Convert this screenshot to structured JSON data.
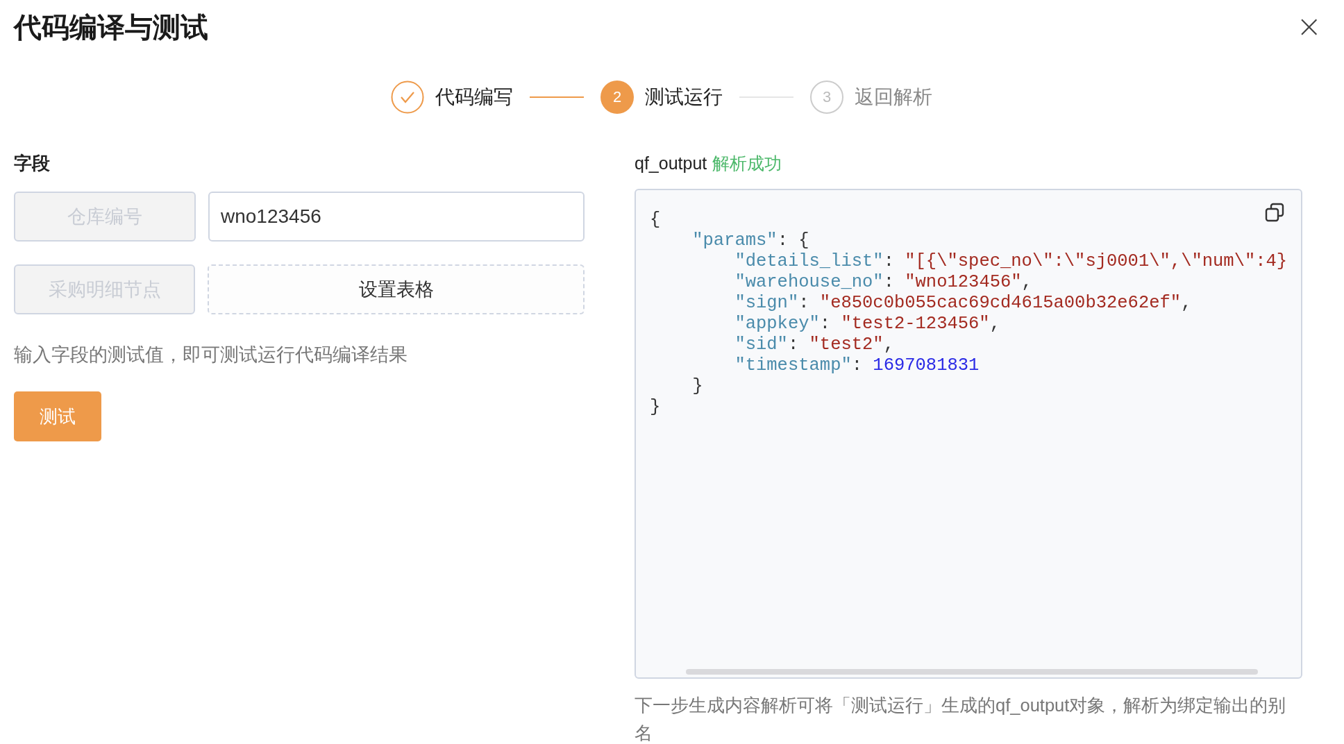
{
  "dialog": {
    "title": "代码编译与测试",
    "close_icon": "×"
  },
  "steps": [
    {
      "label": "代码编写",
      "completed": true,
      "selected": false
    },
    {
      "label": "测试运行",
      "number": "2",
      "completed": false,
      "selected": true
    },
    {
      "label": "返回解析",
      "number": "3",
      "completed": false,
      "selected": false
    }
  ],
  "fields": {
    "heading": "字段",
    "rows": [
      {
        "label": "仓库编号",
        "kind": "input",
        "value": "wno123456"
      },
      {
        "label": "采购明细节点",
        "kind": "button",
        "value": "设置表格"
      }
    ],
    "hint": "输入字段的测试值，即可测试运行代码编译结果",
    "test_button": "测试"
  },
  "output": {
    "name": "qf_output",
    "status": "解析成功",
    "code_lines": [
      {
        "tokens": [
          {
            "kind": "punct",
            "text": "{"
          }
        ],
        "children": [
          {
            "tokens": [
              {
                "kind": "key",
                "text": "\"params\""
              },
              {
                "kind": "punct",
                "text": ": {"
              }
            ],
            "children": [
              {
                "tokens": [
                  {
                    "kind": "key",
                    "text": "\"details_list\""
                  },
                  {
                    "kind": "punct",
                    "text": ": "
                  },
                  {
                    "kind": "string",
                    "text": "\"[{\\\"spec_no\\\":\\\"sj0001\\\",\\\"num\\\":4}"
                  }
                ]
              },
              {
                "tokens": [
                  {
                    "kind": "key",
                    "text": "\"warehouse_no\""
                  },
                  {
                    "kind": "punct",
                    "text": ": "
                  },
                  {
                    "kind": "string",
                    "text": "\"wno123456\""
                  },
                  {
                    "kind": "punct",
                    "text": ","
                  }
                ]
              },
              {
                "tokens": [
                  {
                    "kind": "key",
                    "text": "\"sign\""
                  },
                  {
                    "kind": "punct",
                    "text": ": "
                  },
                  {
                    "kind": "string",
                    "text": "\"e850c0b055cac69cd4615a00b32e62ef\""
                  },
                  {
                    "kind": "punct",
                    "text": ","
                  }
                ]
              },
              {
                "tokens": [
                  {
                    "kind": "key",
                    "text": "\"appkey\""
                  },
                  {
                    "kind": "punct",
                    "text": ": "
                  },
                  {
                    "kind": "string",
                    "text": "\"test2-123456\""
                  },
                  {
                    "kind": "punct",
                    "text": ","
                  }
                ]
              },
              {
                "tokens": [
                  {
                    "kind": "key",
                    "text": "\"sid\""
                  },
                  {
                    "kind": "punct",
                    "text": ": "
                  },
                  {
                    "kind": "string",
                    "text": "\"test2\""
                  },
                  {
                    "kind": "punct",
                    "text": ","
                  }
                ]
              },
              {
                "tokens": [
                  {
                    "kind": "key",
                    "text": "\"timestamp\""
                  },
                  {
                    "kind": "punct",
                    "text": ": "
                  },
                  {
                    "kind": "number",
                    "text": "1697081831"
                  }
                ]
              }
            ]
          },
          {
            "tokens": [
              {
                "kind": "punct",
                "text": "}"
              }
            ]
          }
        ]
      },
      {
        "tokens": [
          {
            "kind": "punct",
            "text": "}"
          }
        ]
      }
    ],
    "note": "下一步生成内容解析可将「测试运行」生成的qf_output对象，解析为绑定输出的别名"
  }
}
